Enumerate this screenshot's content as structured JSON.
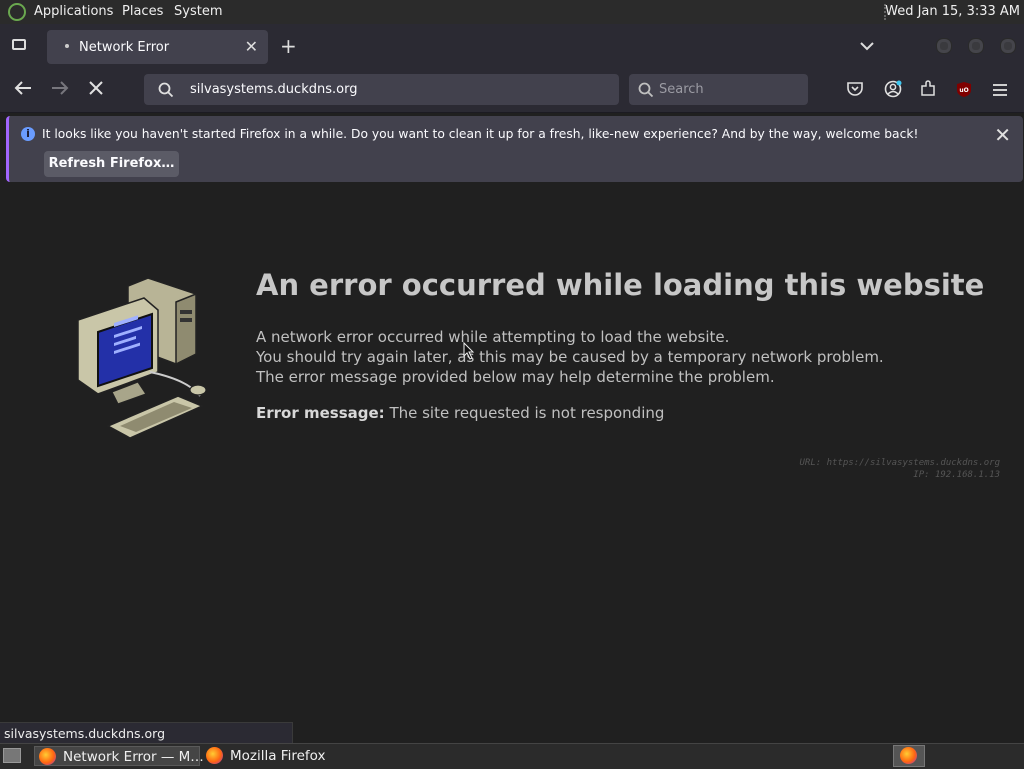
{
  "panel": {
    "menus": [
      "Applications",
      "Places",
      "System"
    ],
    "clock": "Wed Jan 15,  3:33 AM"
  },
  "tab": {
    "title": "Network Error"
  },
  "navbar": {
    "url": "silvasystems.duckdns.org",
    "search_placeholder": "Search"
  },
  "notification": {
    "message": "It looks like you haven't started Firefox in a while. Do you want to clean it up for a fresh, like-new experience? And by the way, welcome back!",
    "button": "Refresh Firefox…"
  },
  "error": {
    "title": "An error occurred while loading this website",
    "lines": [
      "A network error occurred while attempting to load the website.",
      "You should try again later, as this may be caused by a temporary network problem.",
      "The error message provided below may help determine the problem."
    ],
    "message_label": "Error message:",
    "message_value": "The site requested is not responding",
    "url_line": "URL: https://silvasystems.duckdns.org",
    "ip_line": "IP: 192.168.1.13"
  },
  "status_tip": "silvasystems.duckdns.org",
  "taskbar": {
    "items": [
      "Network Error — M…",
      "Mozilla Firefox"
    ]
  }
}
